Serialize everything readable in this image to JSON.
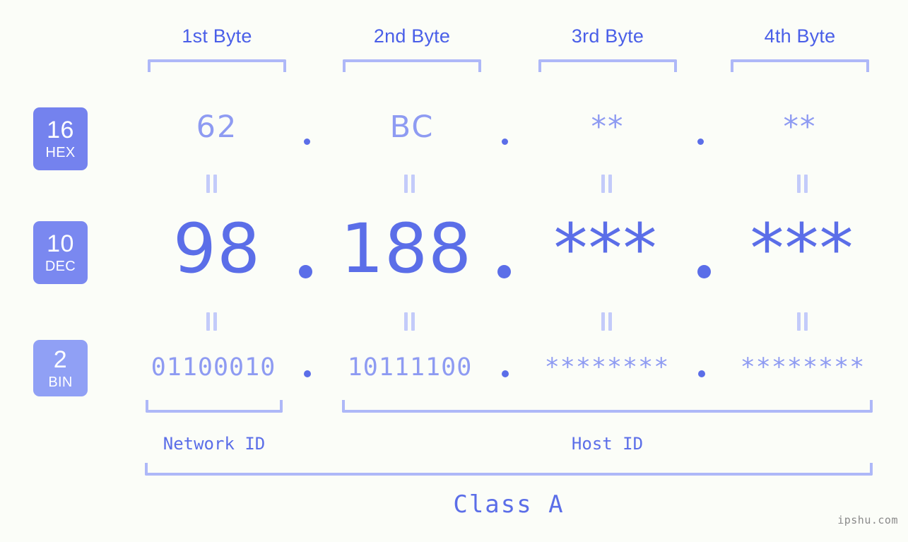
{
  "background_color": "#fbfdf8",
  "accent_color": "#5b6ee8",
  "accent_light_color": "#8e9bf2",
  "bracket_color": "#aeb8f8",
  "header": {
    "bytes": [
      {
        "label": "1st Byte"
      },
      {
        "label": "2nd Byte"
      },
      {
        "label": "3rd Byte"
      },
      {
        "label": "4th Byte"
      }
    ]
  },
  "bases": [
    {
      "number": "16",
      "name": "HEX",
      "color": "#7482ee"
    },
    {
      "number": "10",
      "name": "DEC",
      "color": "#7a88f0"
    },
    {
      "number": "2",
      "name": "BIN",
      "color": "#90a0f5"
    }
  ],
  "rows": {
    "hex": {
      "values": [
        "62",
        "BC",
        "**",
        "**"
      ],
      "separator": "."
    },
    "dec": {
      "values": [
        "98",
        "188",
        "***",
        "***"
      ],
      "separator": "."
    },
    "bin": {
      "values": [
        "01100010",
        "10111100",
        "********",
        "********"
      ],
      "separator": "."
    }
  },
  "equals_marks": {
    "symbol": "="
  },
  "footer": {
    "network_id_label": "Network ID",
    "host_id_label": "Host ID",
    "class_label": "Class A",
    "watermark": "ipshu.com"
  }
}
